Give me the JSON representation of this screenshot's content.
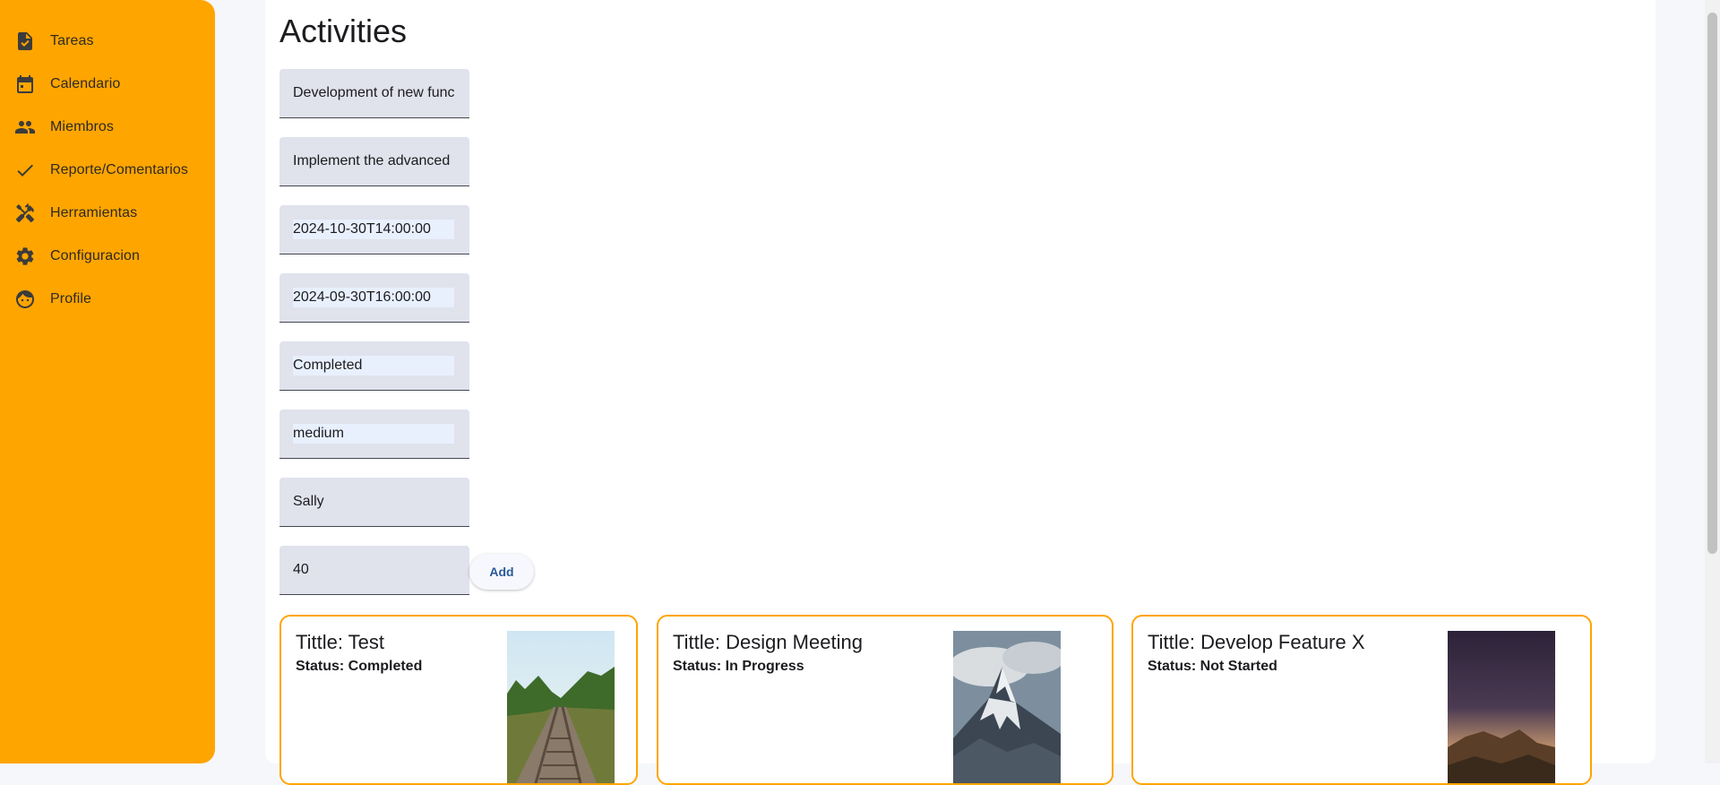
{
  "sidebar": {
    "items": [
      {
        "label": "Tareas",
        "icon": "task-icon"
      },
      {
        "label": "Calendario",
        "icon": "calendar-icon"
      },
      {
        "label": "Miembros",
        "icon": "people-icon"
      },
      {
        "label": "Reporte/Comentarios",
        "icon": "check-icon"
      },
      {
        "label": "Herramientas",
        "icon": "tools-icon"
      },
      {
        "label": "Configuracion",
        "icon": "gear-icon"
      },
      {
        "label": "Profile",
        "icon": "face-icon"
      }
    ],
    "color": "#ffa500"
  },
  "main": {
    "title": "Activities",
    "form": {
      "title_value": "Development of new functionality",
      "description_value": "Implement the advanced search feature",
      "start_value": "2024-10-30T14:00:00",
      "end_value": "2024-09-30T16:00:00",
      "status_value": "Completed",
      "priority_value": "medium",
      "assignee_value": "Sally",
      "progress_value": "40",
      "add_label": "Add"
    },
    "cards": [
      {
        "title": "Tittle: Test",
        "status": "Status: Completed",
        "image": "railway-tracks-image"
      },
      {
        "title": "Tittle: Design Meeting",
        "status": "Status: In Progress",
        "image": "snowy-mountain-image"
      },
      {
        "title": "Tittle: Develop Feature X",
        "status": "Status: Not Started",
        "image": "rocky-cliff-dusk-image"
      }
    ]
  },
  "colors": {
    "accent": "#ffa500",
    "field_bg": "#e0e2ec",
    "button_text": "#2a5a9a"
  }
}
